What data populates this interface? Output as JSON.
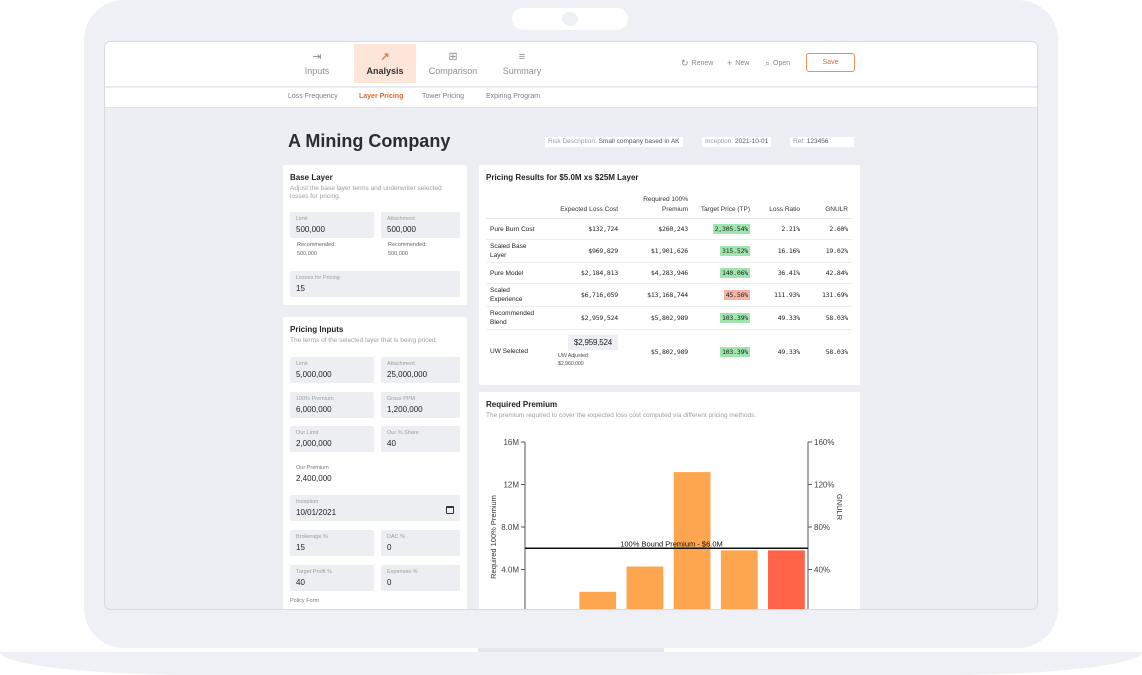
{
  "nav": {
    "tabs": [
      {
        "label": "Inputs",
        "icon": "import-icon"
      },
      {
        "label": "Analysis",
        "icon": "trend-line-icon"
      },
      {
        "label": "Comparison",
        "icon": "grid-plus-icon"
      },
      {
        "label": "Summary",
        "icon": "list-icon"
      }
    ],
    "actions": {
      "renew": "Renew",
      "new": "New",
      "open": "Open",
      "save": "Save"
    },
    "subtabs": [
      "Loss Frequency",
      "Layer Pricing",
      "Tower Pricing",
      "Expiring Program"
    ]
  },
  "header": {
    "title": "A Mining Company",
    "risk_description_label": "Risk Description:",
    "risk_description": "Small company based in AK",
    "inception_label": "Inception:",
    "inception": "2021-10-01",
    "ref_label": "Ref:",
    "ref": "123456"
  },
  "base_layer": {
    "title": "Base Layer",
    "description_line1": "Adjust the base layer terms and underwriter selected",
    "description_line2": "losses for pricing.",
    "limit_label": "Limit",
    "limit": "500,000",
    "limit_rec_label": "Recommended:",
    "limit_rec": "500,000",
    "attachment_label": "Attachment",
    "attachment": "500,000",
    "attachment_rec_label": "Recommended:",
    "attachment_rec": "500,000",
    "losses_label": "Losses for Pricing",
    "losses": "15"
  },
  "pricing_inputs": {
    "title": "Pricing Inputs",
    "description": "The terms of the selected layer that is being priced.",
    "limit_label": "Limit",
    "limit": "5,000,000",
    "attachment_label": "Attachment",
    "attachment": "25,000,000",
    "premium_label": "100% Premium",
    "premium": "6,000,000",
    "gross_ppm_label": "Gross PPM",
    "gross_ppm": "1,200,000",
    "our_limit_label": "Our Limit",
    "our_limit": "2,000,000",
    "our_share_label": "Our % Share",
    "our_share": "40",
    "our_premium_label": "Our Premium",
    "our_premium": "2,400,000",
    "inception_label": "Inception",
    "inception": "10/01/2021",
    "brokerage_label": "Brokerage %",
    "brokerage": "15",
    "dac_label": "DAC %",
    "dac": "0",
    "target_profit_label": "Target Profit %",
    "target_profit": "40",
    "expenses_label": "Expenses %",
    "expenses": "0",
    "policy_form_label": "Policy Form"
  },
  "pricing_results": {
    "title": "Pricing Results for $5.0M xs $25M Layer",
    "headers": [
      "",
      "Expected Loss Cost",
      "Required 100% Premium",
      "Target Price (TP)",
      "Loss Ratio",
      "GNULR"
    ],
    "rows": [
      {
        "name": "Pure Burn Cost",
        "elc": "$132,724",
        "premium": "$260,243",
        "tp": "2,305.54%",
        "tp_status": "green",
        "lr": "2.21%",
        "gnulr": "2.60%"
      },
      {
        "name": "Scaled Base Layer",
        "elc": "$969,829",
        "premium": "$1,901,626",
        "tp": "315.52%",
        "tp_status": "green",
        "lr": "16.16%",
        "gnulr": "19.02%"
      },
      {
        "name": "Pure Model",
        "elc": "$2,184,813",
        "premium": "$4,283,946",
        "tp": "140.06%",
        "tp_status": "green",
        "lr": "36.41%",
        "gnulr": "42.84%"
      },
      {
        "name": "Scaled Experience",
        "elc": "$6,716,059",
        "premium": "$13,168,744",
        "tp": "45.56%",
        "tp_status": "red",
        "lr": "111.93%",
        "gnulr": "131.69%"
      },
      {
        "name": "Recommended Blend",
        "elc": "$2,959,524",
        "premium": "$5,802,989",
        "tp": "103.39%",
        "tp_status": "green",
        "lr": "49.33%",
        "gnulr": "58.03%"
      }
    ],
    "uw_selected": {
      "name": "UW Selected",
      "elc": "$2,959,524",
      "adjusted_label": "UW Adjusted:",
      "adjusted": "$2,960,000",
      "premium": "$5,802,989",
      "tp": "103.39%",
      "tp_status": "green",
      "lr": "49.33%",
      "gnulr": "58.03%"
    }
  },
  "required_premium": {
    "title": "Required Premium",
    "description": "The premium required to cover the expected loss cost computed via different pricing methods."
  },
  "chart_data": {
    "type": "bar",
    "title": "Required Premium",
    "ylabel": "Required 100% Premium",
    "y2label": "GNULR",
    "ylim": [
      0,
      16
    ],
    "y2lim": [
      0,
      160
    ],
    "y_ticks": [
      "4.0M",
      "8.0M",
      "12M",
      "16M"
    ],
    "y_tick_values": [
      4,
      8,
      12,
      16
    ],
    "y2_ticks": [
      "40%",
      "80%",
      "120%",
      "160%"
    ],
    "y2_tick_values": [
      40,
      80,
      120,
      160
    ],
    "values": [
      0.26,
      1.9,
      4.28,
      13.17,
      5.8,
      5.8
    ],
    "bar_colors": [
      "#fda64f",
      "#fda64f",
      "#fda64f",
      "#fda64f",
      "#fda64f",
      "#ff6348"
    ],
    "reference_line": {
      "value": 6.0,
      "label": "100% Bound Premium - $6.0M"
    }
  },
  "colors": {
    "accent": "#e07a4a",
    "bar": "#fda64f",
    "bar_selected": "#ff6348",
    "good": "#9fe5ae",
    "bad": "#f5b5a5"
  }
}
